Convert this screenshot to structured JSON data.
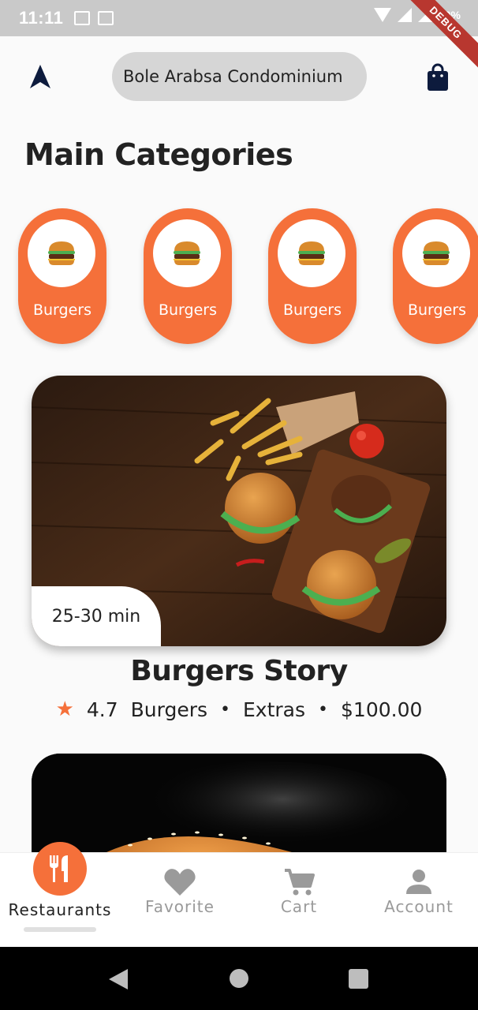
{
  "status_bar": {
    "time": "11:11",
    "battery": "40%",
    "debug_ribbon": "DEBUG"
  },
  "header": {
    "address": "Bole Arabsa Condominium"
  },
  "main": {
    "title": "Main Categories",
    "categories": [
      {
        "label": "Burgers",
        "icon": "burger-icon"
      },
      {
        "label": "Burgers",
        "icon": "burger-icon"
      },
      {
        "label": "Burgers",
        "icon": "burger-icon"
      },
      {
        "label": "Burgers",
        "icon": "burger-icon"
      }
    ],
    "restaurants": [
      {
        "delivery_time": "25-30 min",
        "name": "Burgers Story",
        "rating": "4.7",
        "tags": [
          "Burgers",
          "Extras"
        ],
        "price": "$100.00"
      }
    ]
  },
  "bottom_nav": {
    "tabs": [
      {
        "label": "Restaurants",
        "icon": "restaurant-icon",
        "active": true
      },
      {
        "label": "Favorite",
        "icon": "heart-icon",
        "active": false
      },
      {
        "label": "Cart",
        "icon": "cart-icon",
        "active": false
      },
      {
        "label": "Account",
        "icon": "person-icon",
        "active": false
      }
    ]
  },
  "colors": {
    "accent": "#f5703a",
    "inactive": "#9a9a9a",
    "navy": "#0d1b3d"
  }
}
